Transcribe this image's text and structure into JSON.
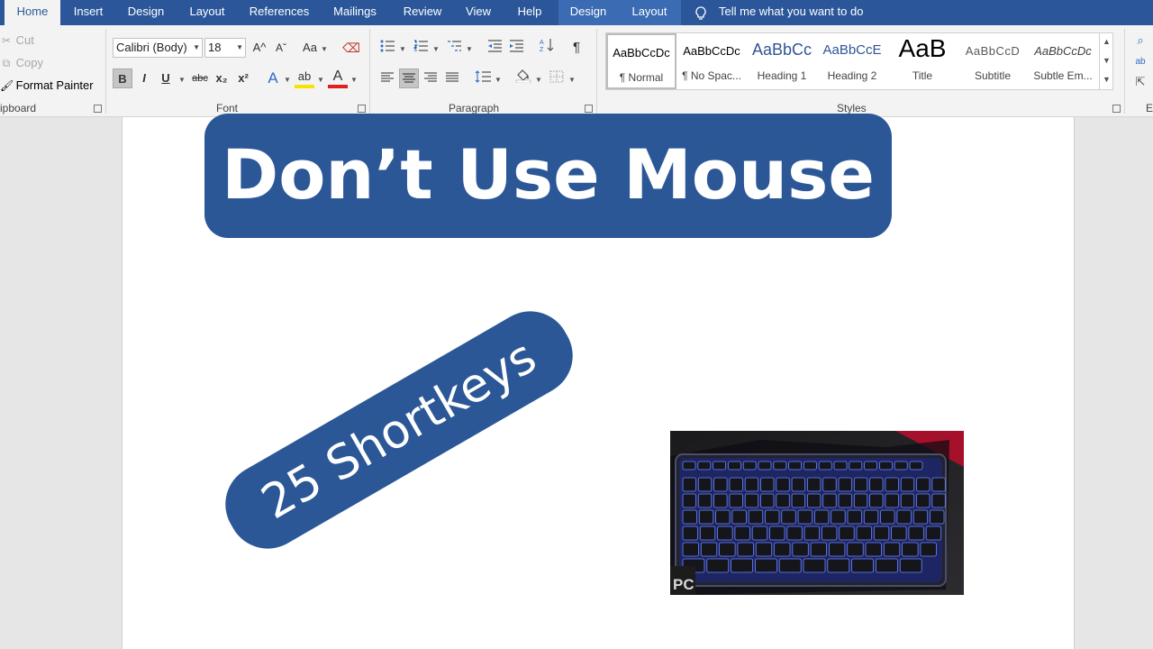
{
  "tabs": [
    {
      "label": "Home",
      "active": true
    },
    {
      "label": "Insert"
    },
    {
      "label": "Design"
    },
    {
      "label": "Layout"
    },
    {
      "label": "References"
    },
    {
      "label": "Mailings"
    },
    {
      "label": "Review"
    },
    {
      "label": "View"
    },
    {
      "label": "Help"
    },
    {
      "label": "Design",
      "contextual": true
    },
    {
      "label": "Layout",
      "contextual": true
    }
  ],
  "tell_me": "Tell me what you want to do",
  "clipboard": {
    "cut": "Cut",
    "copy": "Copy",
    "format_painter": "Format Painter",
    "label": "ipboard"
  },
  "font": {
    "name": "Calibri (Body)",
    "size": "18",
    "label": "Font",
    "bold": "B",
    "italic": "I",
    "underline": "U",
    "strike": "abc",
    "subscript": "x₂",
    "superscript": "x²",
    "grow": "A^",
    "shrink": "Aˇ",
    "case": "Aa",
    "effects": "A",
    "highlight": "ab",
    "color": "A"
  },
  "paragraph": {
    "label": "Paragraph",
    "pilcrow": "¶"
  },
  "styles": {
    "label": "Styles",
    "items": [
      {
        "preview": "AaBbCcDc",
        "name": "¶ Normal",
        "selected": true
      },
      {
        "preview": "AaBbCcDc",
        "name": "¶ No Spac..."
      },
      {
        "preview": "AaBbCc",
        "name": "Heading 1"
      },
      {
        "preview": "AaBbCcE",
        "name": "Heading 2"
      },
      {
        "preview": "AaB",
        "name": "Title"
      },
      {
        "preview": "AaBbCcD",
        "name": "Subtitle"
      },
      {
        "preview": "AaBbCcDc",
        "name": "Subtle Em..."
      }
    ]
  },
  "editing": {
    "label": "E"
  },
  "document": {
    "banner": "Don’t Use Mouse",
    "badge": "25 Shortkeys",
    "image_caption": "PC"
  },
  "colors": {
    "ribbon_blue": "#2b579a",
    "banner_blue": "#2b5797",
    "heading_blue": "#2f5496"
  }
}
